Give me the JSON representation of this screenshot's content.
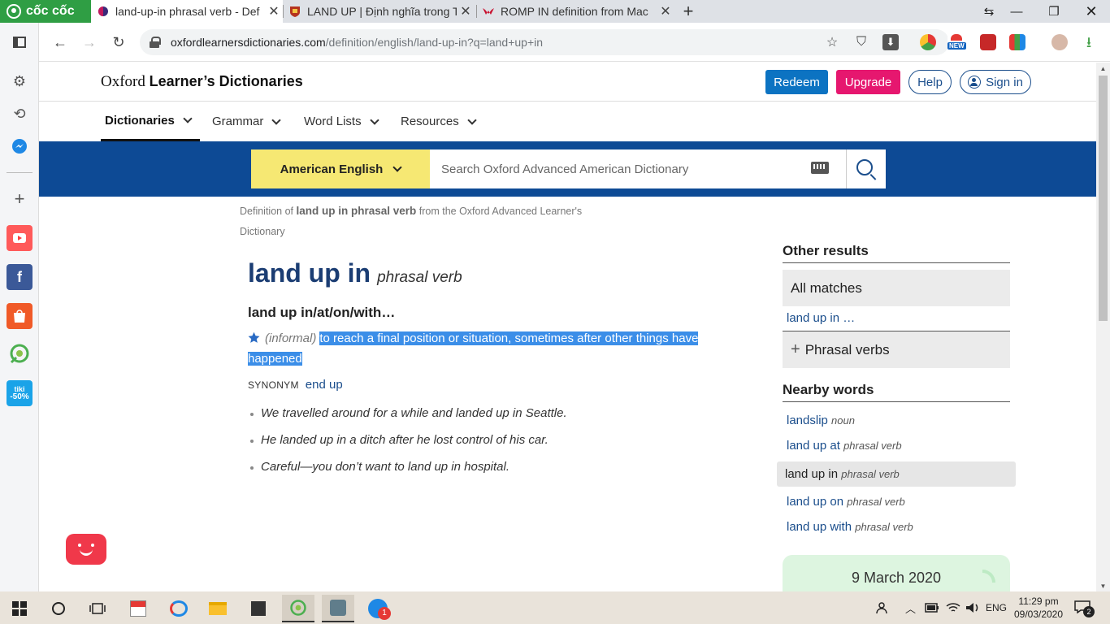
{
  "browser": {
    "brand": "cốc cốc",
    "tabs": [
      {
        "title": "land-up-in phrasal verb - Def",
        "active": true
      },
      {
        "title": "LAND UP | Định nghĩa trong T",
        "active": false
      },
      {
        "title": "ROMP IN definition from Mac",
        "active": false
      }
    ],
    "url_host": "oxfordlearnersdictionaries.com",
    "url_path": "/definition/english/land-up-in?q=land+up+in",
    "ext_new_badge": "NEW"
  },
  "sidebar": {
    "tiki_label": "tiki",
    "tiki_discount": "-50%"
  },
  "site": {
    "logo_light": "Oxford",
    "logo_bold": "Learner’s Dictionaries",
    "redeem": "Redeem",
    "upgrade": "Upgrade",
    "help": "Help",
    "signin": "Sign in",
    "nav": [
      "Dictionaries",
      "Grammar",
      "Word Lists",
      "Resources"
    ],
    "dict_select": "American English",
    "search_placeholder": "Search Oxford Advanced American Dictionary"
  },
  "entry": {
    "crumb_pre": "Definition of ",
    "crumb_bold": "land up in phrasal verb",
    "crumb_post": " from the Oxford Advanced Learner's Dictionary",
    "headword": "land up in",
    "pos": "phrasal verb",
    "variant": "land up in/at/on/with…",
    "register": "(informal)",
    "definition": "to reach a final position or situation, sometimes after other things have happened",
    "synonym_label": "SYNONYM",
    "synonym": "end up",
    "examples": [
      "We travelled around for a while and landed up in Seattle.",
      "He landed up in a ditch after he lost control of his car.",
      "Careful—you don’t want to land up in hospital."
    ]
  },
  "rail": {
    "other_results": "Other results",
    "all_matches": "All matches",
    "match_link": "land up in …",
    "phrasal_verbs": "Phrasal verbs",
    "nearby_heading": "Nearby words",
    "nearby": [
      {
        "word": "landslip",
        "pos": "noun"
      },
      {
        "word": "land up at",
        "pos": "phrasal verb"
      },
      {
        "word": "land up in",
        "pos": "phrasal verb"
      },
      {
        "word": "land up on",
        "pos": "phrasal verb"
      },
      {
        "word": "land up with",
        "pos": "phrasal verb"
      }
    ],
    "wotd_date": "9 March 2020"
  },
  "taskbar": {
    "lang": "ENG",
    "time": "11:29 pm",
    "date": "09/03/2020",
    "notif_count": "2",
    "zalo_badge": "1"
  }
}
